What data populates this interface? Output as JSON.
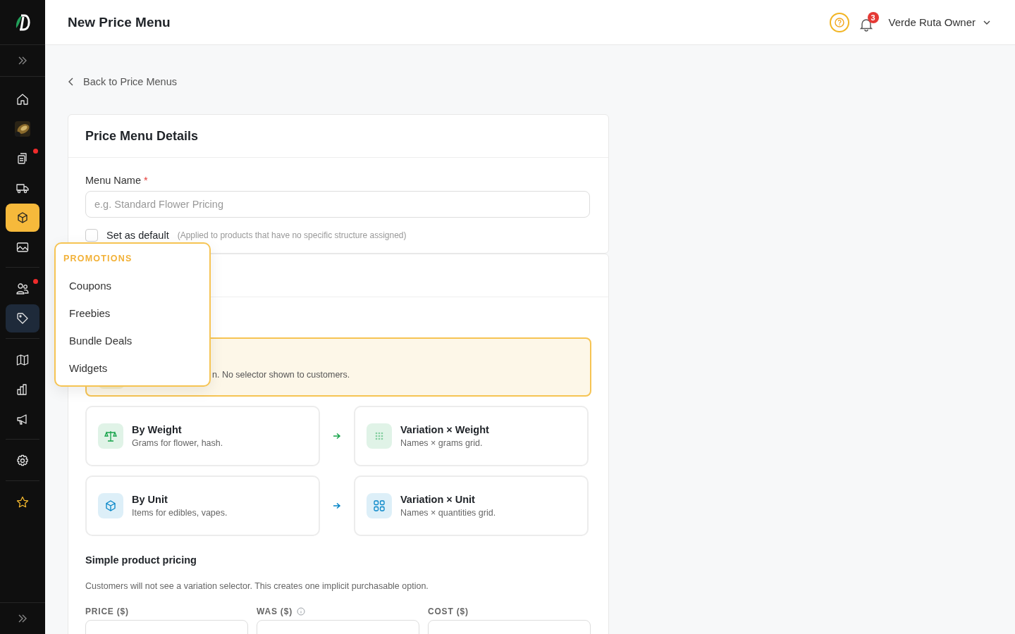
{
  "header": {
    "title": "New Price Menu",
    "notifications": "3",
    "user": "Verde Ruta Owner"
  },
  "nav_groups": [
    {
      "items": [
        {
          "selected": false,
          "expanded": false,
          "dot": false
        },
        {
          "selected": false,
          "expanded": false,
          "dot": false
        },
        {
          "selected": false,
          "expanded": false,
          "dot": true
        },
        {
          "selected": false,
          "expanded": false,
          "dot": false
        },
        {
          "selected": true,
          "expanded": false,
          "dot": false
        },
        {
          "selected": false,
          "expanded": false,
          "dot": false
        }
      ]
    },
    {
      "items": [
        {
          "selected": false,
          "expanded": false,
          "dot": true
        },
        {
          "selected": false,
          "expanded": true,
          "dot": false
        }
      ]
    },
    {
      "items": [
        {
          "selected": false,
          "expanded": false,
          "dot": false
        },
        {
          "selected": false,
          "expanded": false,
          "dot": false
        },
        {
          "selected": false,
          "expanded": false,
          "dot": false
        }
      ]
    },
    {
      "items": [
        {
          "selected": false,
          "expanded": false,
          "dot": false
        }
      ]
    },
    {
      "items": [
        {
          "selected": false,
          "expanded": false,
          "dot": false
        }
      ]
    }
  ],
  "back_link": "Back to Price Menus",
  "details": {
    "title": "Price Menu Details",
    "name_label": "Menu Name",
    "required_mark": "*",
    "name_placeholder": "e.g. Standard Flower Pricing",
    "default_checked": false,
    "default_label": "Set as default",
    "default_hint": "(Applied to products that have no specific structure assigned)"
  },
  "structure": {
    "selected_option_description": "n. No selector shown to customers.",
    "rows": [
      {
        "color": "#16a34a",
        "left": {
          "title": "By Weight",
          "description": "Grams for flower, hash."
        },
        "right": {
          "title": "Variation × Weight",
          "description": "Names × grams grid."
        }
      },
      {
        "color": "#0284c7",
        "left": {
          "title": "By Unit",
          "description": "Items for edibles, vapes."
        },
        "right": {
          "title": "Variation × Unit",
          "description": "Names × quantities grid."
        }
      }
    ],
    "simple_title": "Simple product pricing",
    "simple_note": "Customers will not see a variation selector. This creates one implicit purchasable option.",
    "fields": [
      {
        "label": "PRICE ($)",
        "info": false
      },
      {
        "label": "WAS ($)",
        "info": true
      },
      {
        "label": "COST ($)",
        "info": false
      }
    ]
  },
  "popup": {
    "heading": "PROMOTIONS",
    "items": [
      "Coupons",
      "Freebies",
      "Bundle Deals",
      "Widgets"
    ]
  }
}
